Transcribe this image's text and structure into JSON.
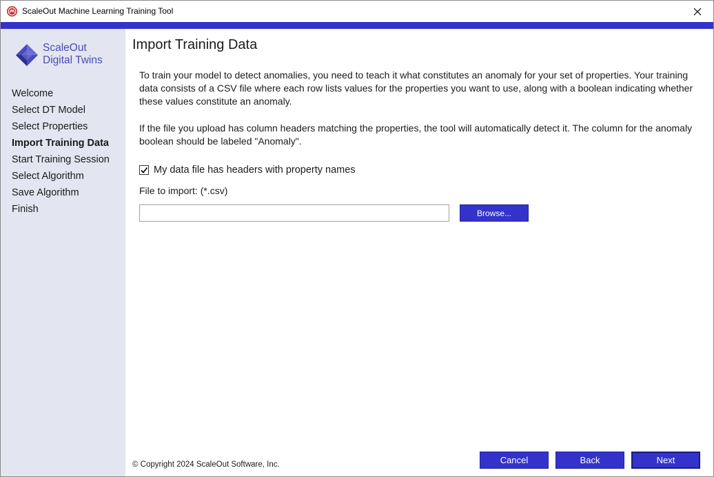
{
  "window": {
    "title": "ScaleOut Machine Learning Training Tool",
    "accent_color": "#3333cc",
    "sidebar_bg": "#e3e6f0"
  },
  "logo": {
    "line1": "ScaleOut",
    "line2": "Digital Twins",
    "icon": "diamond-logo-icon"
  },
  "sidebar": {
    "items": [
      {
        "label": "Welcome",
        "active": false
      },
      {
        "label": "Select DT Model",
        "active": false
      },
      {
        "label": "Select Properties",
        "active": false
      },
      {
        "label": "Import Training Data",
        "active": true
      },
      {
        "label": "Start Training Session",
        "active": false
      },
      {
        "label": "Select Algorithm",
        "active": false
      },
      {
        "label": "Save Algorithm",
        "active": false
      },
      {
        "label": "Finish",
        "active": false
      }
    ]
  },
  "main": {
    "title": "Import Training Data",
    "paragraph1": "To train your model to detect anomalies, you need to teach it what constitutes an anomaly for your set of properties. Your training data consists of a CSV file where each row lists values for the properties you want to use, along with a boolean indicating whether these values constitute an anomaly.",
    "paragraph2": "If the file you upload has column headers matching the properties, the tool will automatically detect it. The column for the anomaly boolean should be labeled \"Anomaly\".",
    "checkbox_label": "My data file has headers with property names",
    "checkbox_checked": true,
    "file_label": "File to import: (*.csv)",
    "file_value": "",
    "browse_label": "Browse..."
  },
  "footer": {
    "copyright": "© Copyright 2024 ScaleOut Software, Inc.",
    "cancel_label": "Cancel",
    "back_label": "Back",
    "next_label": "Next"
  }
}
